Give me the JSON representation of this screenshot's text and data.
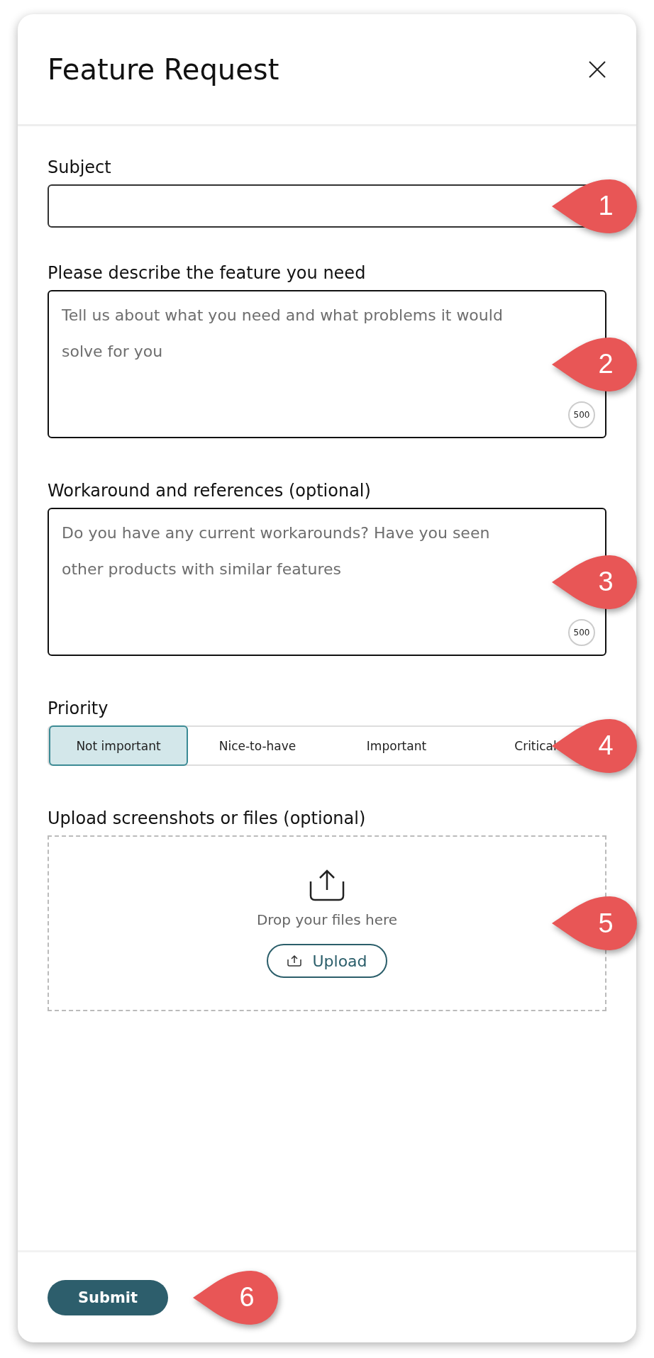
{
  "dialog": {
    "title": "Feature Request"
  },
  "fields": [
    {
      "kind": "text",
      "label": "Subject",
      "callout": "1"
    },
    {
      "kind": "textarea",
      "label": "Please describe the feature you need",
      "placeholder": "Tell us about what you need and what problems it would solve for you",
      "counter": "500",
      "callout": "2"
    },
    {
      "kind": "textarea",
      "label": "Workaround and references (optional)",
      "placeholder": "Do you have any current workarounds? Have you seen other products with similar features",
      "counter": "500",
      "callout": "3"
    },
    {
      "kind": "segments",
      "label": "Priority",
      "callout": "4",
      "options": [
        {
          "label": "Not important",
          "selected": true
        },
        {
          "label": "Nice-to-have",
          "selected": false
        },
        {
          "label": "Important",
          "selected": false
        },
        {
          "label": "Critical",
          "selected": false
        }
      ]
    },
    {
      "kind": "upload",
      "label": "Upload screenshots or files (optional)",
      "drop_text": "Drop your files here",
      "button": "Upload",
      "callout": "5"
    }
  ],
  "footer": {
    "submit": "Submit",
    "callout": "6"
  }
}
